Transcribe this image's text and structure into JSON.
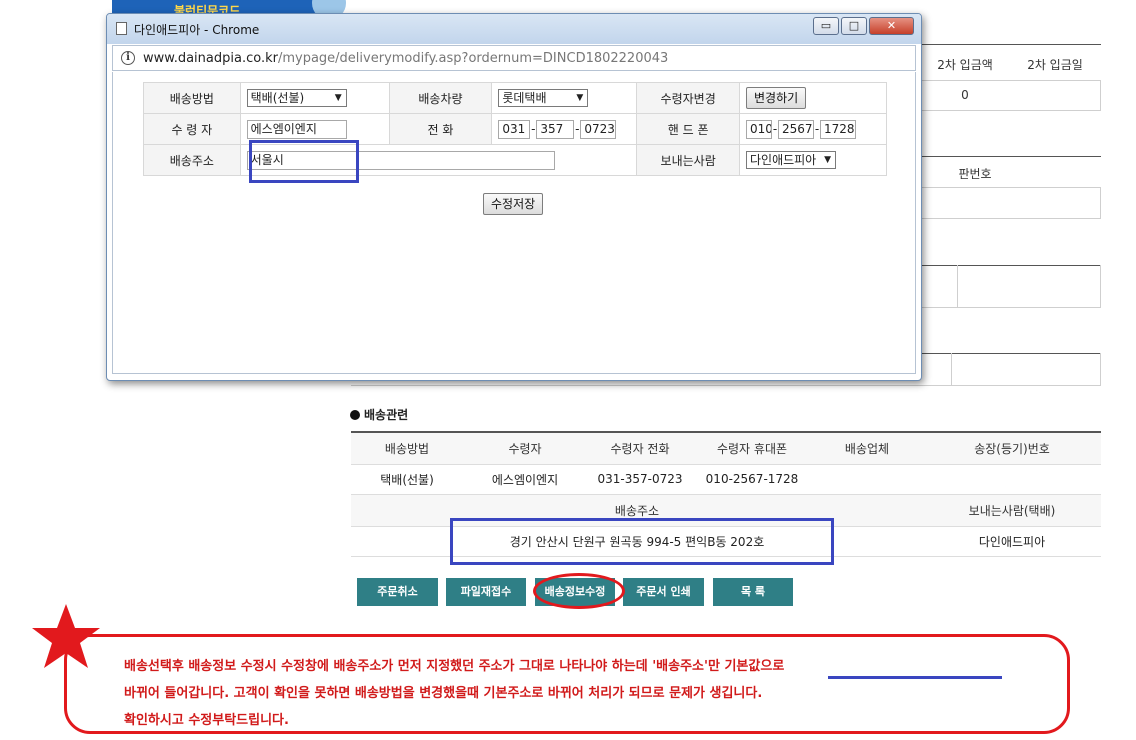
{
  "background": {
    "banner_text": "불런티문코드",
    "payment_headers": [
      "2차 입금액",
      "2차 입금일"
    ],
    "payment_value": "0",
    "plate_header": "판번호"
  },
  "popup": {
    "window_title": "다인애드피아 - Chrome",
    "url_host": "www.dainadpia.co.kr",
    "url_path": "/mypage/deliverymodify.asp?ordernum=DINCD1802220043",
    "labels": {
      "method": "배송방법",
      "vehicle": "배송차량",
      "change_recipient": "수령자변경",
      "recipient": "수 령 자",
      "phone": "전 화",
      "mobile": "핸 드 폰",
      "address": "배송주소",
      "sender": "보내는사람"
    },
    "method_selected": "택배(선불)",
    "vehicle_selected": "롯데택배",
    "change_button": "변경하기",
    "recipient_value": "에스엠이엔지",
    "phone": [
      "031",
      "357",
      "0723"
    ],
    "mobile": [
      "010",
      "2567",
      "1728"
    ],
    "address_value": "서울시",
    "sender_selected": "다인애드피아",
    "save_button": "수정저장"
  },
  "delivery": {
    "section_title": "배송관련",
    "headers": [
      "배송방법",
      "수령자",
      "수령자 전화",
      "수령자 휴대폰",
      "배송업체",
      "송장(등기)번호"
    ],
    "row": [
      "택배(선불)",
      "에스엠이엔지",
      "031-357-0723",
      "010-2567-1728",
      "",
      ""
    ],
    "address_header": "배송주소",
    "sender_header": "보내는사람(택배)",
    "address_value": "경기 안산시 단원구 원곡동 994-5 편익B동 202호",
    "sender_value": "다인애드피아"
  },
  "actions": {
    "cancel_order": "주문취소",
    "file_resubmit": "파일재접수",
    "edit_delivery": "배송정보수정",
    "print_order": "주문서 인쇄",
    "list": "목 록"
  },
  "note": {
    "line1_a": "배송선택후 배송정보 수정시 수정창에 배송주소가 먼저 지정했던 주소가 그대로 나타나야 하는데 ",
    "line1_b": "'배송주소'만 기본값으로",
    "line2": "바뀌어 들어갑니다. 고객이 확인을 못하면 배송방법을 변경했을때 기본주소로 바뀌어 처리가 되므로 문제가 생깁니다.",
    "line3": "확인하시고 수정부탁드립니다."
  },
  "colors": {
    "teal_button": "#2f7f86",
    "annotation_red": "#e2191d",
    "highlight_blue": "#3a46c0"
  }
}
